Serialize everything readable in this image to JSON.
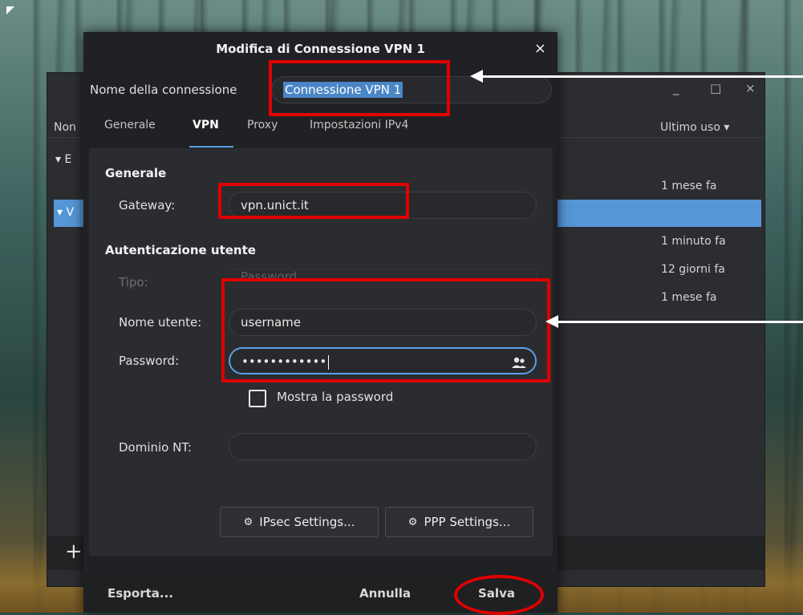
{
  "dialog": {
    "title": "Modifica di Connessione VPN 1",
    "close_glyph": "×",
    "connection_name_label": "Nome della connessione",
    "connection_name_value": "Connessione VPN 1",
    "tabs": [
      {
        "label": "Generale"
      },
      {
        "label": "VPN"
      },
      {
        "label": "Proxy"
      },
      {
        "label": "Impostazioni IPv4"
      }
    ],
    "active_tab": "VPN",
    "general": {
      "section_title": "Generale",
      "gateway_label": "Gateway:",
      "gateway_value": "vpn.unict.it"
    },
    "auth": {
      "section_title": "Autenticazione utente",
      "type_label": "Tipo:",
      "type_value": "Password",
      "username_label": "Nome utente:",
      "username_value": "username",
      "password_label": "Password:",
      "password_value": "••••••••••••",
      "show_password_label": "Mostra la password",
      "nt_domain_label": "Dominio NT:",
      "nt_domain_value": ""
    },
    "buttons": {
      "ipsec": "IPsec Settings...",
      "ppp": "PPP Settings..."
    },
    "footer": {
      "export": "Esporta...",
      "cancel": "Annulla",
      "save": "Salva"
    }
  },
  "back_window": {
    "col_name_partial": "Non",
    "col_last_used": "Ultimo uso",
    "last_used_values": [
      "1 mese fa",
      "1 minuto fa",
      "12 giorni fa",
      "1 mese fa"
    ],
    "add_glyph": "+",
    "minimize_glyph": "_",
    "maximize_glyph": "□",
    "close_glyph": "×",
    "group_letters": [
      "E",
      "V"
    ]
  },
  "colors": {
    "annotation_red": "#e00000",
    "selection_blue": "#5596d6",
    "focus_blue": "#5aa0e6"
  }
}
